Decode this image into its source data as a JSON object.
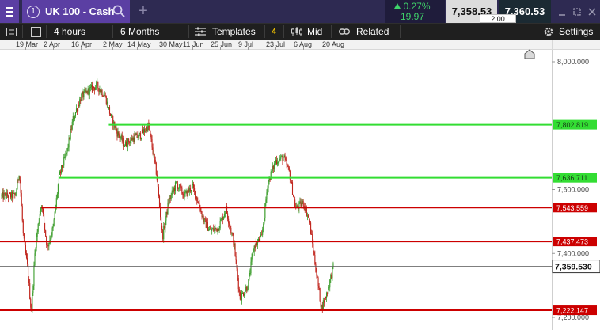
{
  "header": {
    "instrument_number": "1",
    "instrument_name": "UK 100 - Cash",
    "add_tab_symbol": "+",
    "change_percent": "0.27%",
    "change_points": "19.97",
    "sell_price": "7,358.53",
    "buy_price": "7,360.53",
    "spread": "2.00",
    "icons": [
      "menu-icon",
      "search-icon",
      "plus-icon",
      "arrow-up-icon",
      "minimize-icon",
      "maximize-icon",
      "close-icon"
    ]
  },
  "toolbar": {
    "interval": "4 hours",
    "period": "6 Months",
    "templates_label": "Templates",
    "templates_count": "4",
    "price_type": "Mid",
    "related_label": "Related",
    "settings_label": "Settings",
    "icons": [
      "panels-icon",
      "grid-icon",
      "templates-icon",
      "candles-icon",
      "link-icon",
      "gear-icon"
    ]
  },
  "colors": {
    "up": "#3a9c2a",
    "down": "#c0241c",
    "support_resistance_green": "#33dd33",
    "support_resistance_red": "#cc0000",
    "current_price_line": "#555555",
    "header_bg": "#2e2a52",
    "accent_purple": "#5b3fa3"
  },
  "chart_data": {
    "type": "candlestick",
    "x_ticks": [
      "19 Mar",
      "2 Apr",
      "16 Apr",
      "2 May",
      "14 May",
      "30 May",
      "11 Jun",
      "25 Jun",
      "9 Jul",
      "23 Jul",
      "6 Aug",
      "20 Aug"
    ],
    "y_ticks": [
      "8,000.000",
      "7,600.000",
      "7,400.000",
      "7,200.000"
    ],
    "y_range": [
      7190,
      8010
    ],
    "current_price": {
      "value": 7359.53,
      "label": "7,359.530"
    },
    "horizontal_lines": [
      {
        "value": 7802.819,
        "label": "7,802.819",
        "color": "green",
        "from": "30 Apr"
      },
      {
        "value": 7636.711,
        "label": "7,636.711",
        "color": "green",
        "from": "5 Apr"
      },
      {
        "value": 7543.559,
        "label": "7,543.559",
        "color": "red",
        "from": "27 Mar"
      },
      {
        "value": 7437.473,
        "label": "7,437.473",
        "color": "red",
        "from": "19 Mar"
      },
      {
        "value": 7222.147,
        "label": "7,222.147",
        "color": "red",
        "from": "19 Mar"
      }
    ],
    "approx_closes": [
      {
        "date": "14 Mar",
        "value": 7580
      },
      {
        "date": "16 Mar",
        "value": 7660
      },
      {
        "date": "18 Mar",
        "value": 7450
      },
      {
        "date": "20 Mar",
        "value": 7360
      },
      {
        "date": "22 Mar",
        "value": 7215
      },
      {
        "date": "24 Mar",
        "value": 7420
      },
      {
        "date": "27 Mar",
        "value": 7560
      },
      {
        "date": "30 Mar",
        "value": 7420
      },
      {
        "date": "2 Apr",
        "value": 7480
      },
      {
        "date": "5 Apr",
        "value": 7640
      },
      {
        "date": "9 Apr",
        "value": 7720
      },
      {
        "date": "12 Apr",
        "value": 7820
      },
      {
        "date": "16 Apr",
        "value": 7890
      },
      {
        "date": "20 Apr",
        "value": 7910
      },
      {
        "date": "24 Apr",
        "value": 7925
      },
      {
        "date": "28 Apr",
        "value": 7895
      },
      {
        "date": "1 May",
        "value": 7830
      },
      {
        "date": "4 May",
        "value": 7780
      },
      {
        "date": "8 May",
        "value": 7740
      },
      {
        "date": "12 May",
        "value": 7760
      },
      {
        "date": "16 May",
        "value": 7770
      },
      {
        "date": "20 May",
        "value": 7800
      },
      {
        "date": "24 May",
        "value": 7650
      },
      {
        "date": "27 May",
        "value": 7450
      },
      {
        "date": "30 May",
        "value": 7560
      },
      {
        "date": "3 Jun",
        "value": 7620
      },
      {
        "date": "7 Jun",
        "value": 7580
      },
      {
        "date": "11 Jun",
        "value": 7610
      },
      {
        "date": "14 Jun",
        "value": 7560
      },
      {
        "date": "17 Jun",
        "value": 7500
      },
      {
        "date": "20 Jun",
        "value": 7470
      },
      {
        "date": "24 Jun",
        "value": 7480
      },
      {
        "date": "28 Jun",
        "value": 7540
      },
      {
        "date": "2 Jul",
        "value": 7430
      },
      {
        "date": "5 Jul",
        "value": 7260
      },
      {
        "date": "9 Jul",
        "value": 7300
      },
      {
        "date": "12 Jul",
        "value": 7420
      },
      {
        "date": "16 Jul",
        "value": 7450
      },
      {
        "date": "19 Jul",
        "value": 7620
      },
      {
        "date": "23 Jul",
        "value": 7690
      },
      {
        "date": "27 Jul",
        "value": 7700
      },
      {
        "date": "30 Jul",
        "value": 7650
      },
      {
        "date": "2 Aug",
        "value": 7540
      },
      {
        "date": "6 Aug",
        "value": 7560
      },
      {
        "date": "9 Aug",
        "value": 7500
      },
      {
        "date": "12 Aug",
        "value": 7360
      },
      {
        "date": "15 Aug",
        "value": 7230
      },
      {
        "date": "18 Aug",
        "value": 7280
      },
      {
        "date": "21 Aug",
        "value": 7359
      }
    ]
  }
}
